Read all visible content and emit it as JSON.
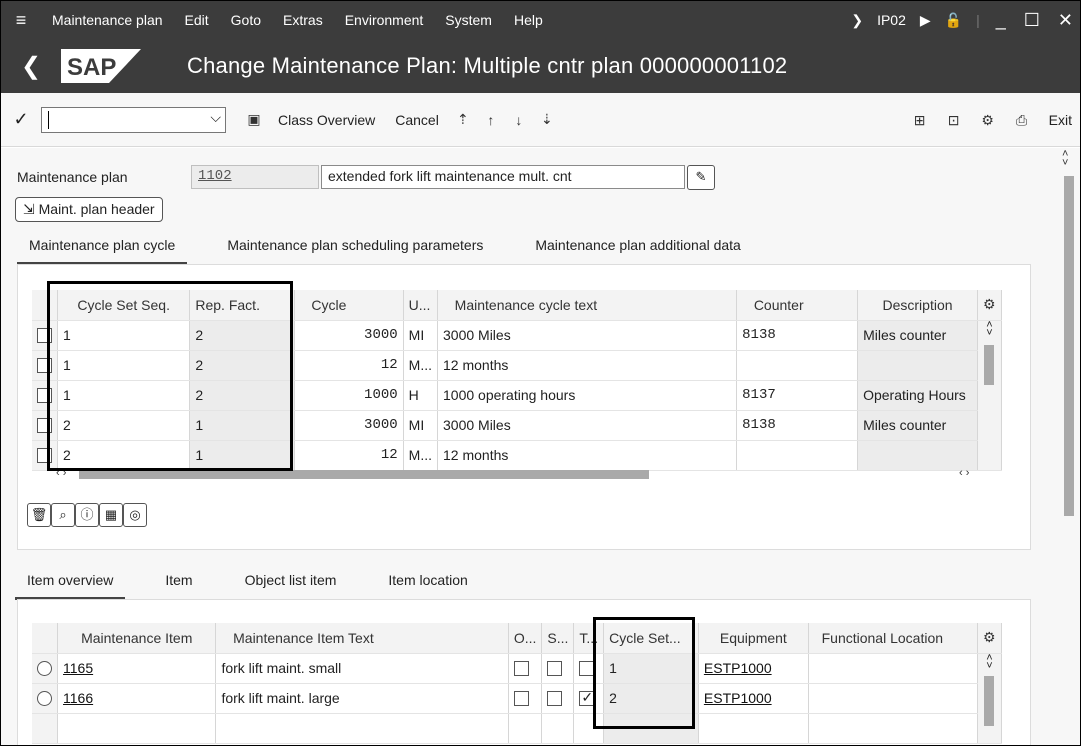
{
  "menubar": {
    "items": [
      "Maintenance plan",
      "Edit",
      "Goto",
      "Extras",
      "Environment",
      "System",
      "Help"
    ],
    "transaction": "IP02"
  },
  "title": {
    "logo": "SAP",
    "text": "Change Maintenance Plan: Multiple cntr plan 000000001102"
  },
  "toolbar": {
    "class_overview": "Class Overview",
    "cancel": "Cancel",
    "exit": "Exit"
  },
  "header": {
    "plan_label": "Maintenance plan",
    "plan_number": "1102",
    "plan_text": "extended fork lift maintenance mult. cnt",
    "header_button": "Maint. plan header"
  },
  "tabs_top": [
    "Maintenance plan cycle",
    "Maintenance plan scheduling parameters",
    "Maintenance plan additional data"
  ],
  "cycle_table": {
    "columns": [
      "Cycle Set Seq.",
      "Rep. Fact.",
      "Cycle",
      "U...",
      "Maintenance cycle text",
      "Counter",
      "Description"
    ],
    "rows": [
      {
        "seq": "1",
        "rep": "2",
        "cycle": "3000",
        "unit": "MI",
        "text": "3000 Miles",
        "counter": "8138",
        "desc": "Miles counter"
      },
      {
        "seq": "1",
        "rep": "2",
        "cycle": "12",
        "unit": "M...",
        "text": "12 months",
        "counter": "",
        "desc": ""
      },
      {
        "seq": "1",
        "rep": "2",
        "cycle": "1000",
        "unit": "H",
        "text": "1000 operating hours",
        "counter": "8137",
        "desc": "Operating Hours"
      },
      {
        "seq": "2",
        "rep": "1",
        "cycle": "3000",
        "unit": "MI",
        "text": "3000 Miles",
        "counter": "8138",
        "desc": "Miles counter"
      },
      {
        "seq": "2",
        "rep": "1",
        "cycle": "12",
        "unit": "M...",
        "text": "12 months",
        "counter": "",
        "desc": ""
      }
    ]
  },
  "tabs_bottom": [
    "Item overview",
    "Item",
    "Object list item",
    "Item location"
  ],
  "item_table": {
    "columns": [
      "Maintenance Item",
      "Maintenance Item Text",
      "O...",
      "S...",
      "T...",
      "Cycle Set...",
      "Equipment",
      "Functional Location"
    ],
    "rows": [
      {
        "item": "1165",
        "text": "fork lift maint. small",
        "cycle_set": "1",
        "equipment": "ESTP1000",
        "t_checked": false
      },
      {
        "item": "1166",
        "text": "fork lift maint. large",
        "cycle_set": "2",
        "equipment": "ESTP1000",
        "t_checked": true
      }
    ]
  },
  "colors": {
    "bar": "#3c3c3c",
    "background": "#f7f7f7"
  }
}
